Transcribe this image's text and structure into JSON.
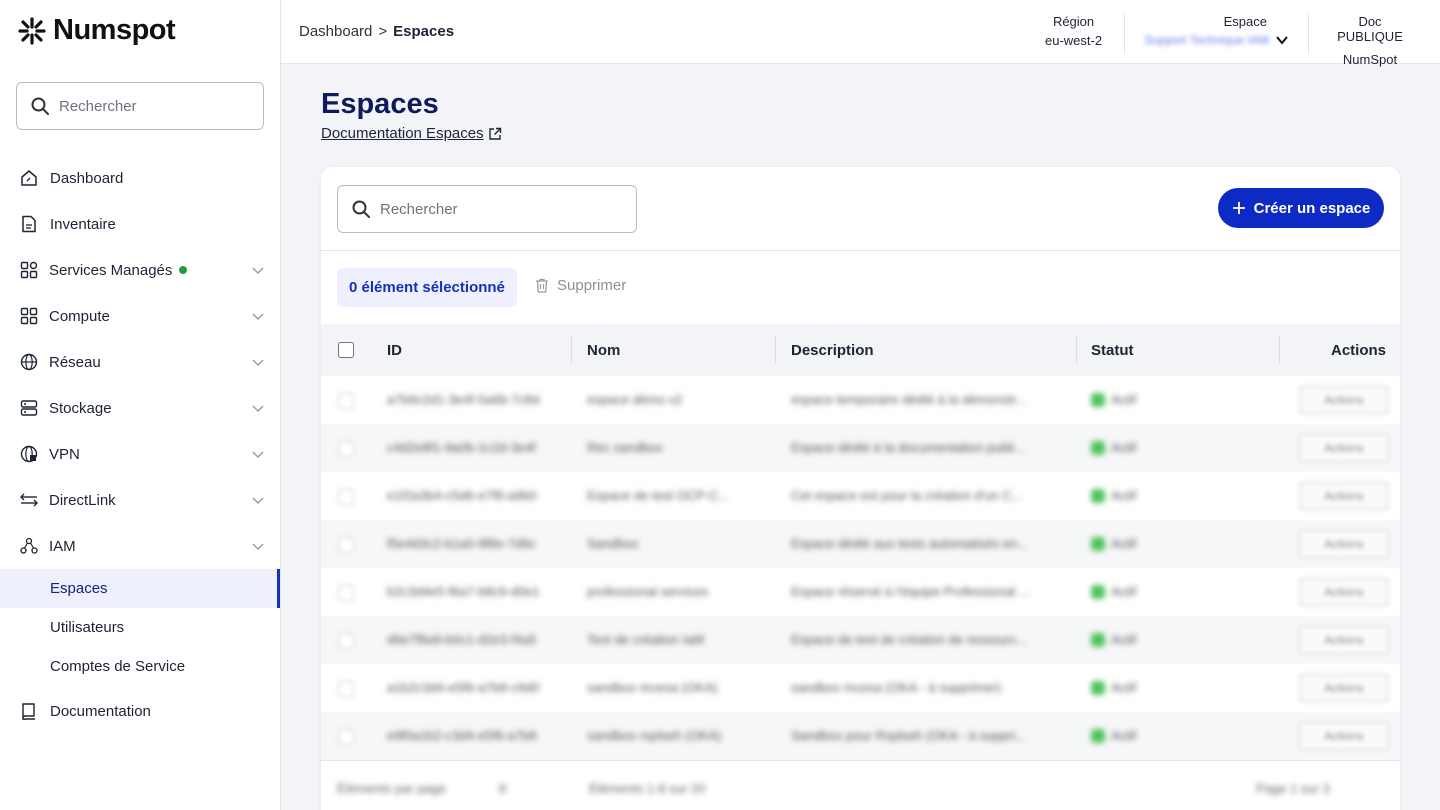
{
  "brand": {
    "name": "Numspot"
  },
  "sidebar": {
    "search_placeholder": "Rechercher",
    "items": [
      {
        "label": "Dashboard",
        "icon": "dashboard-icon"
      },
      {
        "label": "Inventaire",
        "icon": "inventory-icon"
      },
      {
        "label": "Services Managés",
        "icon": "managed-services-icon",
        "status_dot": "#1f9d3a"
      },
      {
        "label": "Compute",
        "icon": "compute-icon"
      },
      {
        "label": "Réseau",
        "icon": "network-icon"
      },
      {
        "label": "Stockage",
        "icon": "storage-icon"
      },
      {
        "label": "VPN",
        "icon": "vpn-icon"
      },
      {
        "label": "DirectLink",
        "icon": "directlink-icon"
      },
      {
        "label": "IAM",
        "icon": "iam-icon"
      }
    ],
    "iam_subitems": [
      {
        "label": "Espaces",
        "active": true
      },
      {
        "label": "Utilisateurs",
        "active": false
      },
      {
        "label": "Comptes de Service",
        "active": false
      }
    ],
    "documentation": {
      "label": "Documentation",
      "icon": "book-icon"
    }
  },
  "topbar": {
    "breadcrumb": {
      "parent": "Dashboard",
      "separator": ">",
      "current": "Espaces"
    },
    "region": {
      "label": "Région",
      "value": "eu-west-2"
    },
    "space": {
      "label": "Espace",
      "value": "Support Technique IAM"
    },
    "doc": {
      "label": "Doc PUBLIQUE",
      "value": "NumSpot"
    }
  },
  "main": {
    "title": "Espaces",
    "doc_link": "Documentation Espaces",
    "search_placeholder": "Rechercher",
    "create_button": "Créer un espace",
    "selection_badge": "0 élément sélectionné",
    "delete_button": "Supprimer",
    "columns": [
      "ID",
      "Nom",
      "Description",
      "Statut",
      "Actions"
    ],
    "rows": [
      {
        "id": "a7b9c2d1-3e4f-5a6b-7c8d",
        "name": "espace démo v2",
        "description": "espace temporaire dédié à la démonstr...",
        "status": "Actif",
        "action": "Actions"
      },
      {
        "id": "c4d2e8f1-9a0b-1c2d-3e4f",
        "name": "Rec sandbox",
        "description": "Espace dédié à la documentation publi...",
        "status": "Actif",
        "action": "Actions"
      },
      {
        "id": "e1f2a3b4-c5d6-e7f8-a9b0",
        "name": "Espace de test OCP-C...",
        "description": "Cet espace est pour la création d'un C...",
        "status": "Actif",
        "action": "Actions"
      },
      {
        "id": "f5e4d3c2-b1a0-9f8e-7d6c",
        "name": "Sandbox",
        "description": "Espace dédié aux tests automatisés en...",
        "status": "Actif",
        "action": "Actions"
      },
      {
        "id": "b2c3d4e5-f6a7-b8c9-d0e1",
        "name": "professional services",
        "description": "Espace réservé à l'équipe Professional ...",
        "status": "Actif",
        "action": "Actions"
      },
      {
        "id": "d6e7f8a9-b0c1-d2e3-f4a5",
        "name": "Test de création IaM",
        "description": "Espace de test de création de ressourc...",
        "status": "Actif",
        "action": "Actions"
      },
      {
        "id": "a1b2c3d4-e5f6-a7b8-c9d0",
        "name": "sandbox mcesa (OKA)",
        "description": "sandbox mcesa (OKA - à supprimer)",
        "status": "Actif",
        "action": "Actions"
      },
      {
        "id": "e9f0a1b2-c3d4-e5f6-a7b8",
        "name": "sandbox rsplseh (OKA)",
        "description": "Sandbox pour Rsplseh (OKA - à suppri...",
        "status": "Actif",
        "action": "Actions"
      }
    ],
    "pagination": {
      "per_page_label": "Éléments par page",
      "per_page_value": "8",
      "range": "Éléments 1-8 sur 20",
      "page": "Page 1 sur 3"
    }
  }
}
